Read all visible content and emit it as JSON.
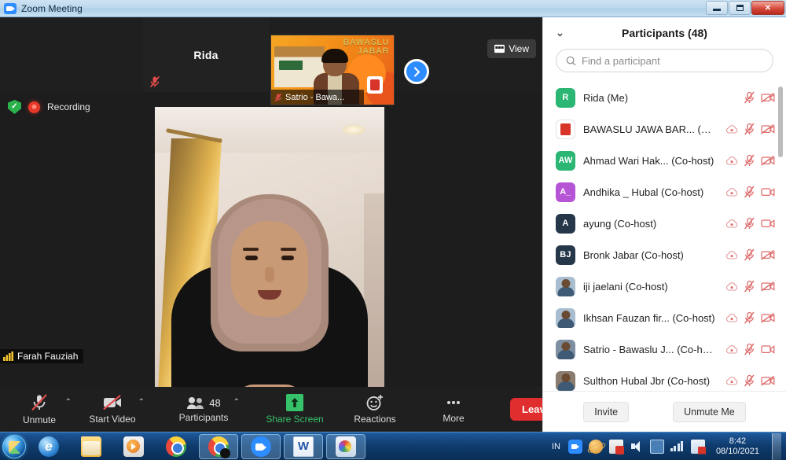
{
  "window": {
    "title": "Zoom Meeting",
    "icon": "zoom-icon",
    "minimize_label": "Minimize",
    "maximize_label": "Maximize",
    "close_label": "Close"
  },
  "stage": {
    "recording_label": "Recording",
    "encryption_icon": "green-shield-icon",
    "self_name": "Farah Fauziah",
    "view_button": "View",
    "next_page_icon": "chevron-right-icon",
    "thumbnails": [
      {
        "name": "Rida",
        "muted": true,
        "has_video": false
      },
      {
        "name": "Satrio - Bawa...",
        "muted": true,
        "has_video": true,
        "overlay_text_line1": "BAWASLU",
        "overlay_text_line2": "JABAR"
      }
    ]
  },
  "toolbar": {
    "items": [
      {
        "label": "Unmute",
        "icon": "microphone-muted-icon",
        "caret": true
      },
      {
        "label": "Start Video",
        "icon": "video-off-icon",
        "caret": true
      },
      {
        "label": "Participants",
        "icon": "participants-icon",
        "badge": "48",
        "caret": true
      },
      {
        "label": "Share Screen",
        "icon": "share-screen-icon",
        "caret": false
      },
      {
        "label": "Reactions",
        "icon": "reactions-icon",
        "caret": false
      },
      {
        "label": "More",
        "icon": "more-dots-icon",
        "caret": false
      }
    ],
    "leave_label": "Leave"
  },
  "participants_panel": {
    "title": "Participants (48)",
    "collapse_icon": "chevron-down-icon",
    "search_placeholder": "Find a participant",
    "search_value": "",
    "search_icon": "search-icon",
    "invite_label": "Invite",
    "unmute_me_label": "Unmute Me",
    "participants": [
      {
        "name": "Rida (Me)",
        "initials": "R",
        "avatar_color": "#2bb673",
        "avatar_type": "initials",
        "recording": false,
        "muted": true,
        "video_off": true
      },
      {
        "name": "BAWASLU JAWA BAR... (Host)",
        "initials": "",
        "avatar_color": "#ffffff",
        "avatar_type": "logo",
        "recording": true,
        "muted": true,
        "video_off": true
      },
      {
        "name": "Ahmad Wari Hak... (Co-host)",
        "initials": "AW",
        "avatar_color": "#2bb673",
        "avatar_type": "initials",
        "recording": true,
        "muted": true,
        "video_off": true
      },
      {
        "name": "Andhika _ Hubal (Co-host)",
        "initials": "A_",
        "avatar_color": "#b654d6",
        "avatar_type": "initials",
        "recording": true,
        "muted": true,
        "video_off": false
      },
      {
        "name": "ayung (Co-host)",
        "initials": "A",
        "avatar_color": "#26374a",
        "avatar_type": "initials",
        "recording": true,
        "muted": true,
        "video_off": false
      },
      {
        "name": "Bronk Jabar (Co-host)",
        "initials": "BJ",
        "avatar_color": "#26374a",
        "avatar_type": "initials",
        "recording": true,
        "muted": true,
        "video_off": true
      },
      {
        "name": "iji jaelani (Co-host)",
        "initials": "",
        "avatar_color": "#a8bdd0",
        "avatar_type": "photo",
        "recording": true,
        "muted": true,
        "video_off": true
      },
      {
        "name": "Ikhsan Fauzan fir... (Co-host)",
        "initials": "",
        "avatar_color": "#a8bdd0",
        "avatar_type": "photo",
        "recording": true,
        "muted": true,
        "video_off": true
      },
      {
        "name": "Satrio - Bawaslu J... (Co-host)",
        "initials": "",
        "avatar_color": "#7d8fa0",
        "avatar_type": "photo",
        "recording": true,
        "muted": true,
        "video_off": false
      },
      {
        "name": "Sulthon Hubal Jbr (Co-host)",
        "initials": "",
        "avatar_color": "#8a7c6e",
        "avatar_type": "photo",
        "recording": true,
        "muted": true,
        "video_off": true
      }
    ]
  },
  "taskbar": {
    "start_label": "Start",
    "apps": [
      {
        "name": "internet-explorer",
        "active": false
      },
      {
        "name": "file-explorer",
        "active": false
      },
      {
        "name": "windows-media-player",
        "active": false
      },
      {
        "name": "google-chrome",
        "active": false
      },
      {
        "name": "google-chrome-window",
        "active": true
      },
      {
        "name": "zoom",
        "active": true
      },
      {
        "name": "microsoft-word",
        "active": true
      },
      {
        "name": "paint",
        "active": true
      }
    ],
    "tray": {
      "language": "IN",
      "icons": [
        "zoom-tray-icon",
        "orbit-icon",
        "security-icon",
        "volume-icon",
        "monitor-icon",
        "network-icon",
        "flag-icon"
      ],
      "time": "8:42",
      "date": "08/10/2021"
    }
  },
  "colors": {
    "zoom_blue": "#2d8cff",
    "leave_red": "#e02d2d",
    "share_green": "#36c26a",
    "mute_red": "#e04b4b",
    "taskbar_blue": "#0e3a6b"
  }
}
